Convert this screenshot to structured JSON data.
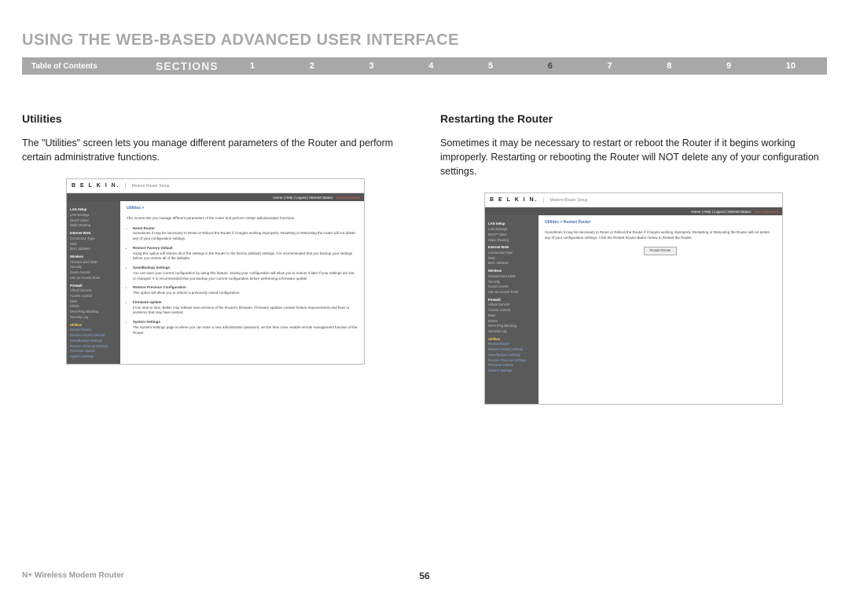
{
  "page_title": "USING THE WEB-BASED ADVANCED USER INTERFACE",
  "section_bar": {
    "toc": "Table of Contents",
    "label": "SECTIONS",
    "nums": [
      "1",
      "2",
      "3",
      "4",
      "5",
      "6",
      "7",
      "8",
      "9",
      "10"
    ],
    "active": "6"
  },
  "left": {
    "heading": "Utilities",
    "lead": "The \"Utilities\" screen lets you manage different parameters of the Router and perform certain administrative functions.",
    "shot": {
      "logo": "B E L K I N.",
      "setup": "Modem-Router Setup",
      "header_links": "Home | Help | Logout | Internet Status:",
      "header_status": "Not Connected",
      "crumb": "Utilities >",
      "intro": "This screen lets you manage different parameters of the router and perform certain administrative functions.",
      "items": [
        {
          "title": "Reset Router",
          "desc": "Sometimes it may be necessary to Reset or Reboot the Router if it begins working improperly. Resetting or Rebooting the router will not delete any of your configuration settings."
        },
        {
          "title": "Restore Factory Default",
          "desc": "Using this option will restore all of the settings in the Router to the factory (default) settings. It is recommended that you backup your settings before you restore all of the defaults."
        },
        {
          "title": "Save/Backup Settings",
          "desc": "You can save your current configuration by using this feature. Saving your configuration will allow you to restore it later if your settings are lost or changed. It is recommended that you backup your current configuration before performing a firmware update."
        },
        {
          "title": "Restore Previous Configuration",
          "desc": "This option will allow you to restore a previously saved configuration."
        },
        {
          "title": "Firmware Update",
          "desc": "From time to time, Belkin may release new versions of the Router's firmware. Firmware updates contain feature improvements and fixes to problems that may have existed."
        },
        {
          "title": "System Settings",
          "desc": "The System Settings page is where you can enter a new administrator password, set the time zone, enable remote management function of the Router."
        }
      ],
      "nav": {
        "groups": [
          {
            "head": "LAN Setup",
            "items": [
              "LAN Settings",
              "DHCP Client"
            ]
          },
          {
            "head": "",
            "items": [
              "Static Routing"
            ]
          },
          {
            "head": "Internet WAN",
            "items": [
              "Connection Type",
              "DNS",
              "MAC Address"
            ]
          },
          {
            "head": "Wireless",
            "items": [
              "Channel and SSID",
              "Security",
              "Guest Access",
              "Use as Access Point"
            ]
          },
          {
            "head": "Firewall",
            "items": [
              "Virtual Servers",
              "Access Control",
              "DMZ",
              "DDNS",
              "WAN Ping Blocking",
              "Security Log"
            ]
          },
          {
            "head": "Utilities",
            "active": true,
            "items": [
              "Restart Router",
              "Restore Factory Default",
              "Save/Backup Settings",
              "Restore Previous Settings",
              "Firmware Update",
              "System Settings"
            ],
            "sub": true
          }
        ]
      }
    }
  },
  "right": {
    "heading": "Restarting the Router",
    "lead": "Sometimes it may be necessary to restart or reboot the Router if it begins working improperly. Restarting or rebooting the Router will NOT delete any of your configuration settings.",
    "shot": {
      "logo": "B E L K I N.",
      "setup": "Modem-Router Setup",
      "header_links": "Home | Help | Logout | Internet Status:",
      "header_status": "Not Connected",
      "crumb": "Utilities > Restart Router",
      "intro": "Sometimes it may be necessary to Reset or Reboot the Router if it begins working improperly. Restarting or Rebooting the Router will not delete any of your configuration settings. Click the Restart Router Button below to Restart the Router.",
      "button": "Restart Router",
      "nav": {
        "groups": [
          {
            "head": "LAN Setup",
            "items": [
              "LAN Settings",
              "DHCP Client"
            ]
          },
          {
            "head": "",
            "items": [
              "Static Routing"
            ]
          },
          {
            "head": "Internet WAN",
            "items": [
              "Connection Type",
              "DNS",
              "MAC Address"
            ]
          },
          {
            "head": "Wireless",
            "items": [
              "Channel and SSID",
              "Security",
              "Guest Access",
              "Use as Access Point"
            ]
          },
          {
            "head": "Firewall",
            "items": [
              "Virtual Servers",
              "Access Control",
              "DMZ",
              "DDNS",
              "WAN Ping Blocking",
              "Security Log"
            ]
          },
          {
            "head": "Utilities",
            "active": true,
            "items": [
              "Restart Router",
              "Restore Factory Default",
              "Save/Backup Settings",
              "Restore Previous Settings",
              "Firmware Update",
              "System Settings"
            ],
            "sub": true,
            "activeItem": "Restart Router"
          }
        ]
      }
    }
  },
  "footer": {
    "product": "N+ Wireless Modem Router",
    "page": "56"
  }
}
